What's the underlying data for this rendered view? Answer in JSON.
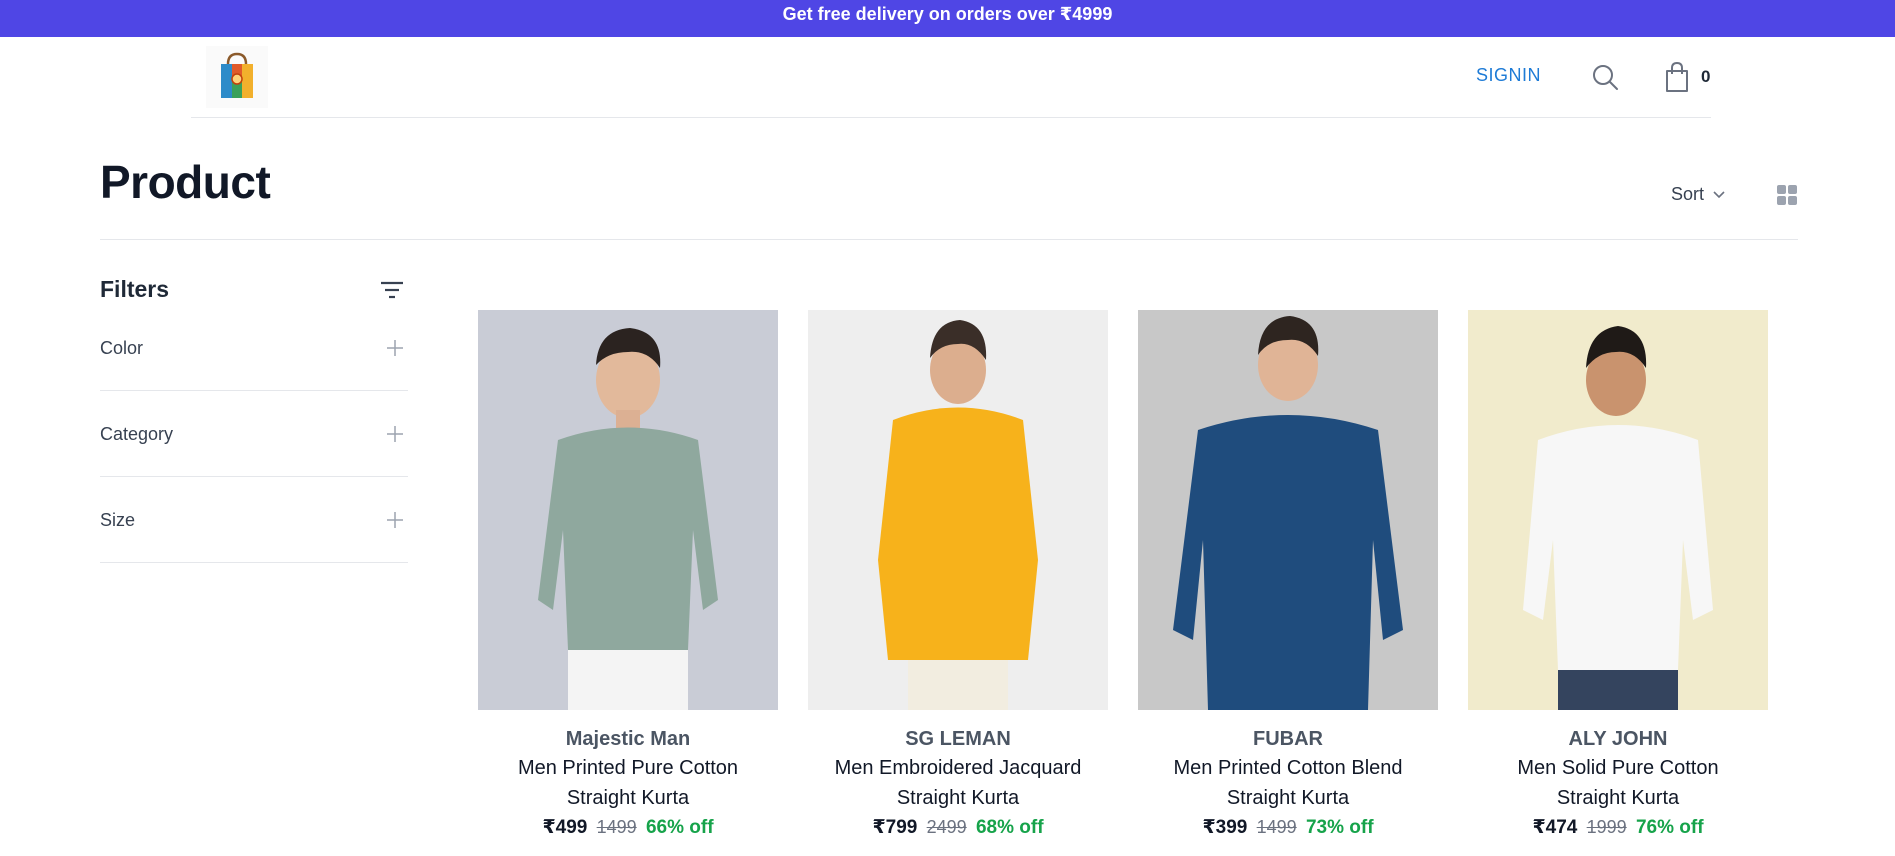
{
  "promo": {
    "text": "Get free delivery on orders over ₹4999"
  },
  "header": {
    "signin": "SIGNIN",
    "cart_count": "0"
  },
  "page": {
    "title": "Product",
    "sort_label": "Sort"
  },
  "filters": {
    "title": "Filters",
    "sections": [
      "Color",
      "Category",
      "Size"
    ]
  },
  "products": [
    {
      "brand": "Majestic Man",
      "name_line1": "Men Printed Pure Cotton",
      "name_line2": "Straight Kurta",
      "price": "₹499",
      "mrp": "1499",
      "off": "66% off",
      "bg": "#c9ccd6",
      "shirt": "#8fa89e"
    },
    {
      "brand": "SG LEMAN",
      "name_line1": "Men Embroidered Jacquard",
      "name_line2": "Straight Kurta",
      "price": "₹799",
      "mrp": "2499",
      "off": "68% off",
      "bg": "#eeeeee",
      "shirt": "#f7b21b"
    },
    {
      "brand": "FUBAR",
      "name_line1": "Men Printed Cotton Blend",
      "name_line2": "Straight Kurta",
      "price": "₹399",
      "mrp": "1499",
      "off": "73% off",
      "bg": "#c8c8c8",
      "shirt": "#1f4c7d"
    },
    {
      "brand": "ALY JOHN",
      "name_line1": "Men Solid Pure Cotton",
      "name_line2": "Straight Kurta",
      "price": "₹474",
      "mrp": "1999",
      "off": "76% off",
      "bg": "#f1ebcc",
      "shirt": "#f7f7f7"
    }
  ],
  "colors": {
    "promo_bg": "#4f46e5",
    "signin": "#1e7bd6",
    "discount": "#16a34a"
  }
}
